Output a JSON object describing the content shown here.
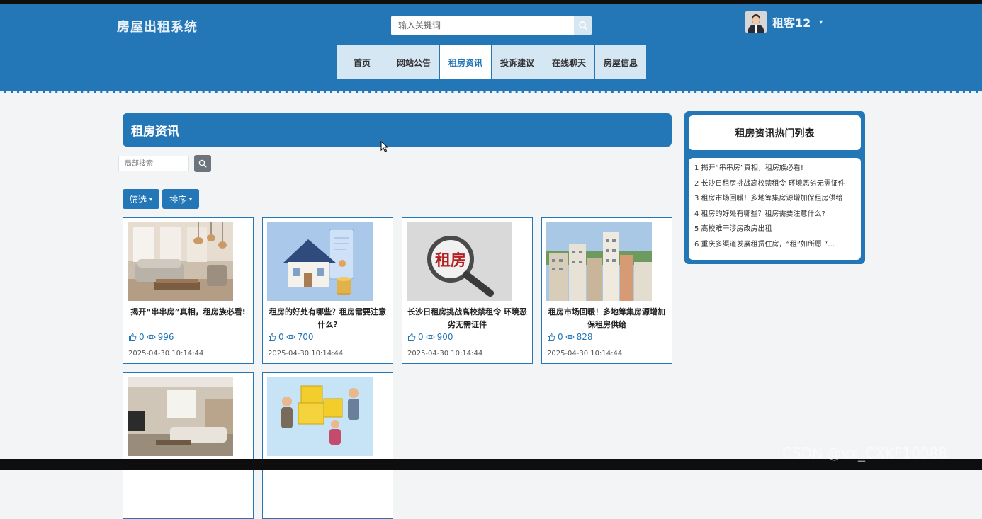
{
  "header": {
    "site_title": "房屋出租系统",
    "search_placeholder": "输入关键词",
    "username": "租客12",
    "caret": "▾"
  },
  "nav": [
    {
      "label": "首页",
      "active": false
    },
    {
      "label": "网站公告",
      "active": false
    },
    {
      "label": "租房资讯",
      "active": true
    },
    {
      "label": "投诉建议",
      "active": false
    },
    {
      "label": "在线聊天",
      "active": false
    },
    {
      "label": "房屋信息",
      "active": false
    }
  ],
  "main": {
    "banner_title": "租房资讯",
    "local_search_placeholder": "局部搜索",
    "filter_label": "筛选",
    "sort_label": "排序",
    "caret": "▾"
  },
  "cards": [
    {
      "title": "揭开“串串房”真相，租房族必看!",
      "likes": "0",
      "views": "996",
      "date": "2025-04-30 10:14:44",
      "image": "living-room"
    },
    {
      "title": "租房的好处有哪些？租房需要注意什么?",
      "likes": "0",
      "views": "700",
      "date": "2025-04-30 10:14:44",
      "image": "house-model"
    },
    {
      "title": "长沙日租房挑战高校禁租令 环境恶劣无需证件",
      "likes": "0",
      "views": "900",
      "date": "2025-04-30 10:14:44",
      "image": "magnifier-rent"
    },
    {
      "title": "租房市场回暖！多地筹集房源增加保租房供给",
      "likes": "0",
      "views": "828",
      "date": "2025-04-30 10:14:44",
      "image": "city-buildings"
    },
    {
      "title": "",
      "likes": "",
      "views": "",
      "date": "",
      "image": "modern-living-room"
    },
    {
      "title": "",
      "likes": "",
      "views": "",
      "date": "",
      "image": "cartoon-family"
    }
  ],
  "sidebar": {
    "title": "租房资讯热门列表",
    "items": [
      "1  揭开“串串房”真相，租房族必看!",
      "2  长沙日租房挑战高校禁租令 环境恶劣无需证件",
      "3  租房市场回暖！多地筹集房源增加保租房供给",
      "4  租房的好处有哪些？租房需要注意什么?",
      "5  高校难干涉房改房出租",
      "6  重庆多渠道发展租赁住房，“租”如所愿 “…"
    ]
  },
  "watermark": "CSDN @vx_CXKF10088",
  "colors": {
    "primary": "#2477b7",
    "nav_bg": "#d6e7f4",
    "page_bg": "#f3f4f6"
  }
}
